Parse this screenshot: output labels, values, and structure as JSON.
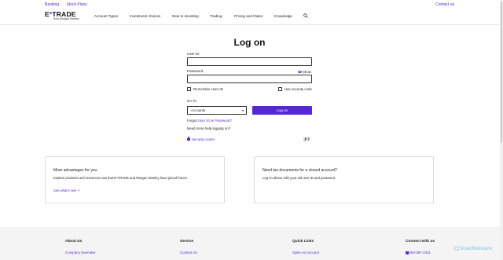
{
  "utility": {
    "banking": "Banking",
    "stock_plans": "Stock Plans",
    "contact": "Contact us"
  },
  "header": {
    "brand": "E*TRADE",
    "brand_sub": "from Morgan Stanley",
    "nav": [
      "Account Types",
      "Investment choices",
      "New to investing",
      "Trading",
      "Pricing and Rates",
      "Knowledge"
    ],
    "search_icon": "search-icon"
  },
  "login": {
    "title": "Log on",
    "user_id_label": "User ID",
    "user_id_value": "",
    "password_label": "Password",
    "password_value": "",
    "show_label": "Show",
    "remember_label": "Remember User ID",
    "remember_checked": false,
    "security_code_label": "Use security code",
    "security_code_checked": false,
    "goto_label": "Go To:",
    "goto_selected": "Accounts",
    "logon_button": "Log on",
    "forgot_prefix": "Forgot",
    "forgot_user_id": "User ID",
    "forgot_or": "or",
    "forgot_password": "Password?",
    "help_link": "Need more help logging on?",
    "security_center": "Security center",
    "language_link": "漢字"
  },
  "cards": [
    {
      "heading": "More advantages for you",
      "body": "Explore products and resources now that E*TRADE and Morgan Stanley have joined forces.",
      "link": "See what's new"
    },
    {
      "heading": "Need tax documents for a closed account?",
      "body": "Log on above with your old user ID and password."
    }
  ],
  "footer": {
    "columns": [
      {
        "heading": "About Us",
        "link": "Company Overview"
      },
      {
        "heading": "Service",
        "link": "Contact Us"
      },
      {
        "heading": "Quick Links",
        "link": "Open An Account"
      },
      {
        "heading": "Connect with us",
        "link": "800-387-2331"
      }
    ]
  },
  "watermark": "ScanMalware",
  "colors": {
    "accent": "#5627d8",
    "footer_bg": "#f4f4f4"
  }
}
